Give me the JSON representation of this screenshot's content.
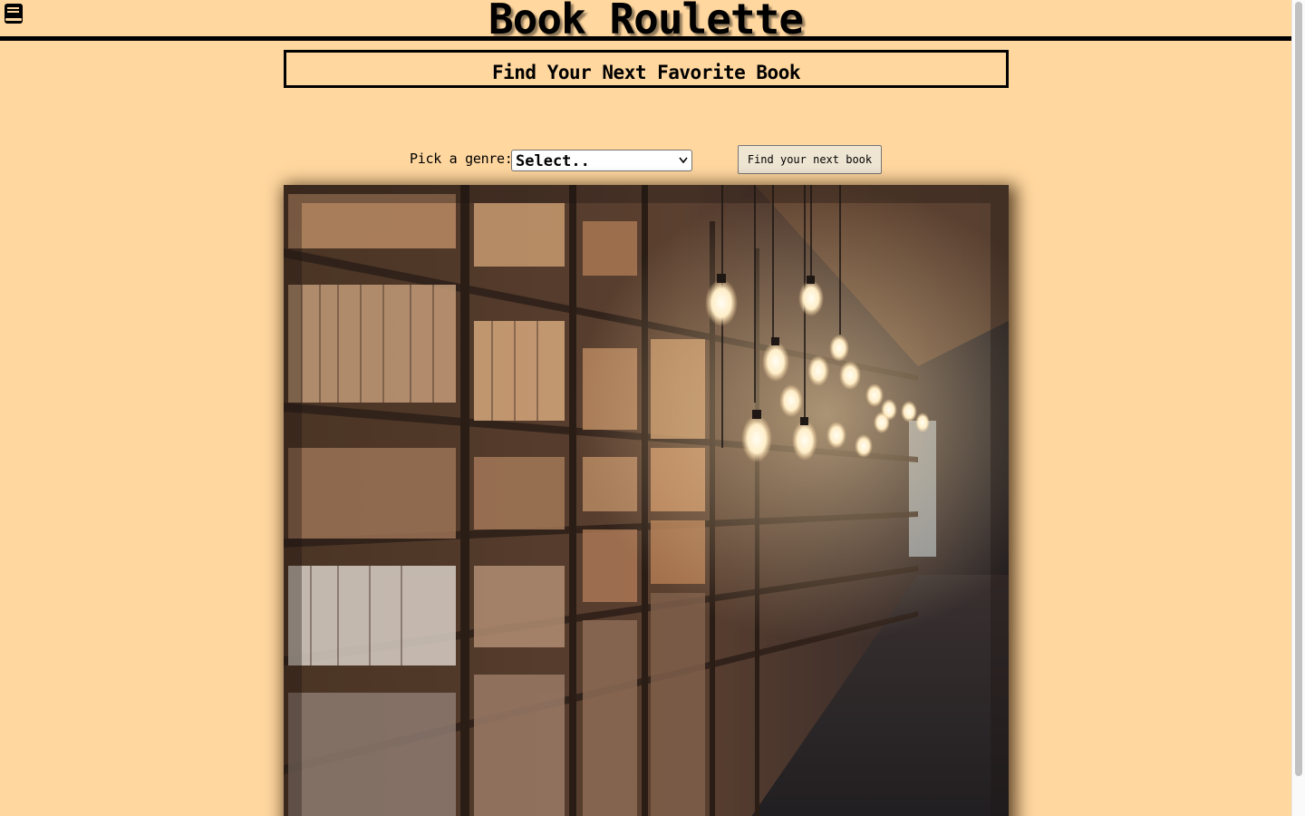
{
  "header": {
    "title": "Book Roulette",
    "logo_icon": "book-icon"
  },
  "subtitle": "Find Your Next Favorite Book",
  "genre_picker": {
    "label": "Pick a genre:",
    "selected": "Select..",
    "button_label": "Find your next book"
  },
  "hero_image": {
    "description_icon": "library-bookshelves-image"
  },
  "colors": {
    "background": "#ffd79f",
    "border": "#000000",
    "button": "#efe5d3"
  }
}
